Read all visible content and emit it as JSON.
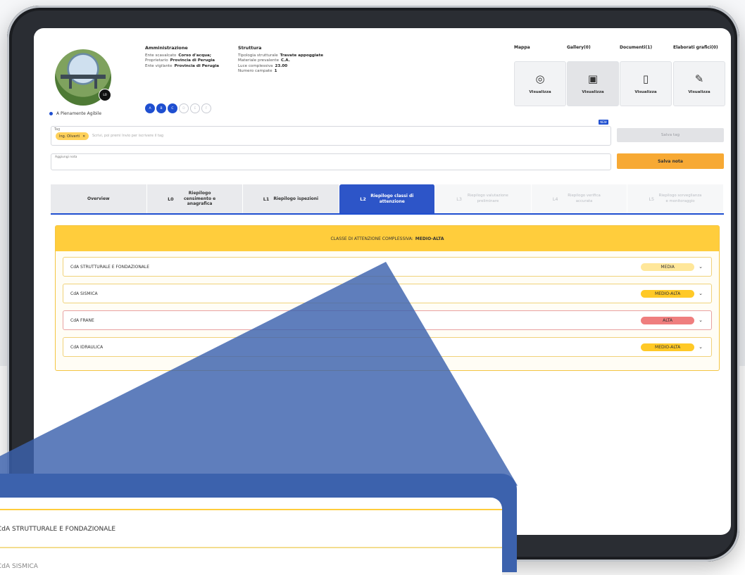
{
  "header": {
    "admin": {
      "title": "Amministrazione",
      "rows": [
        {
          "k": "Ente scavalcato",
          "v": "Corso d'acqua;"
        },
        {
          "k": "Proprietario",
          "v": "Provincia di Perugia"
        },
        {
          "k": "Ente vigilante",
          "v": "Provincia di Perugia"
        }
      ]
    },
    "struttura": {
      "title": "Struttura",
      "rows": [
        {
          "k": "Tipologia strutturale",
          "v": "Travate appoggiate"
        },
        {
          "k": "Materiale prevalente",
          "v": "C.A."
        },
        {
          "k": "Luce complessiva",
          "v": "23.00"
        },
        {
          "k": "Numero campate",
          "v": "1"
        }
      ]
    },
    "avatar_badge": "L0",
    "status_label": "A Pienamente Agibile",
    "steps": [
      "A",
      "B",
      "C",
      "D",
      "E",
      "F"
    ],
    "media": [
      {
        "head": "Mappa",
        "action": "Visualizza",
        "icon": "location-pin-icon",
        "glyph": "◎"
      },
      {
        "head": "Gallery(0)",
        "action": "Visualizza",
        "icon": "camera-icon",
        "glyph": "▣"
      },
      {
        "head": "Documenti(1)",
        "action": "Visualizza",
        "icon": "document-icon",
        "glyph": "▯"
      },
      {
        "head": "Elaborati grafici(0)",
        "action": "Visualizza",
        "icon": "pen-tool-icon",
        "glyph": "✎"
      }
    ]
  },
  "tags": {
    "label": "Tag",
    "chip": "Ing. Oliverti",
    "placeholder": "Scrivi, poi premi Invio per iscrivere il tag",
    "new_badge": "NEW",
    "save_tag_button": "Salva tag"
  },
  "note": {
    "label": "Aggiungi nota",
    "save_button": "Salva nota"
  },
  "tabs": [
    {
      "code": "",
      "label": "Overview",
      "state": "normal"
    },
    {
      "code": "L0",
      "label": "Riepilogo censimento e anagrafica",
      "state": "normal"
    },
    {
      "code": "L1",
      "label": "Riepilogo ispezioni",
      "state": "normal"
    },
    {
      "code": "L2",
      "label": "Riepilogo classi di attenzione",
      "state": "active"
    },
    {
      "code": "L3",
      "label": "Riepilogo valutazione preliminare",
      "state": "disabled"
    },
    {
      "code": "L4",
      "label": "Riepilogo verifica accurata",
      "state": "disabled"
    },
    {
      "code": "L5",
      "label": "Riepilogo sorveglianza e monitoraggio",
      "state": "disabled"
    }
  ],
  "panel": {
    "title_prefix": "CLASSE DI ATTENZIONE COMPLESSIVA:",
    "title_value": "MEDIO-ALTA",
    "rows": [
      {
        "name": "CdA STRUTTURALE E FONDAZIONALE",
        "level": "MEDIA",
        "style": "media"
      },
      {
        "name": "CdA SISMICA",
        "level": "MEDIO-ALTA",
        "style": "medioalta"
      },
      {
        "name": "CdA FRANE",
        "level": "ALTA",
        "style": "alta"
      },
      {
        "name": "CdA IDRAULICA",
        "level": "MEDIO-ALTA",
        "style": "medioalta"
      }
    ]
  },
  "zoom": {
    "row1": "CdA STRUTTURALE E FONDAZIONALE",
    "row2": "CdA SISMICA"
  },
  "colors": {
    "accent": "#1f4fd0",
    "warning": "#ffcd3c",
    "orange": "#f7a934",
    "danger": "#ef7e7e",
    "zoom": "#3c62ad"
  }
}
